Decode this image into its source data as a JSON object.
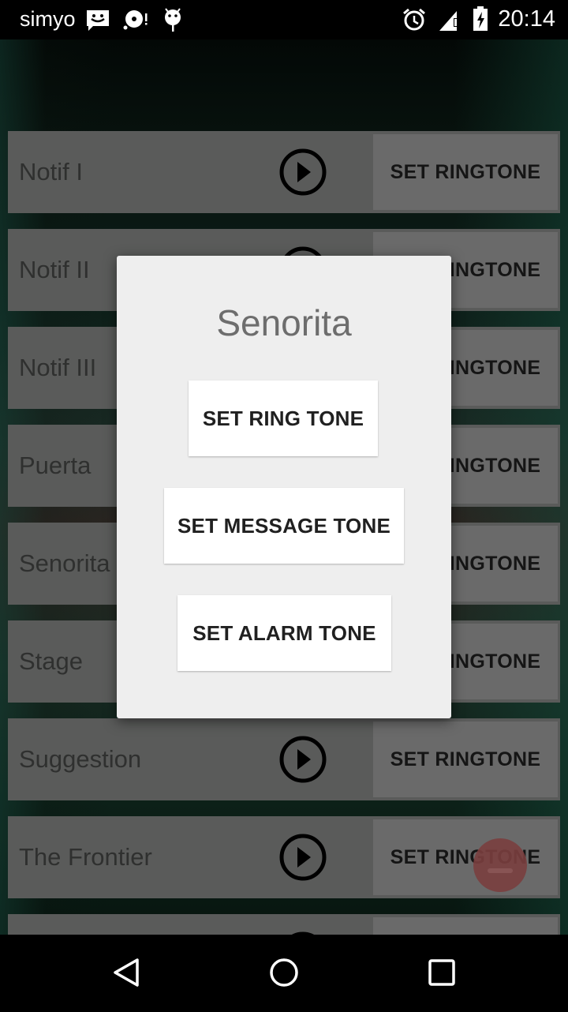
{
  "status_bar": {
    "carrier": "simyo",
    "left_icons": [
      "sms-smiley-icon",
      "sync-disc-alert-icon",
      "android-debug-icon"
    ],
    "right_icons": [
      "alarm-clock-icon",
      "signal-no-data-icon",
      "battery-charging-icon"
    ],
    "time": "20:14"
  },
  "list": {
    "rows": [
      {
        "name": "Notif I",
        "action": "SET RINGTONE"
      },
      {
        "name": "Notif II",
        "action": "SET RINGTONE"
      },
      {
        "name": "Notif III",
        "action": "SET RINGTONE"
      },
      {
        "name": "Puerta",
        "action": "SET RINGTONE"
      },
      {
        "name": "Senorita",
        "action": "SET RINGTONE"
      },
      {
        "name": "Stage",
        "action": "SET RINGTONE"
      },
      {
        "name": "Suggestion",
        "action": "SET RINGTONE"
      },
      {
        "name": "The Frontier",
        "action": "SET RINGTONE"
      },
      {
        "name": "",
        "action": ""
      }
    ]
  },
  "fab": {
    "icon": "menu-icon",
    "color": "#a04848"
  },
  "dialog": {
    "title": "Senorita",
    "buttons": {
      "ring": "SET RING TONE",
      "message": "SET MESSAGE TONE",
      "alarm": "SET ALARM TONE"
    }
  },
  "nav_bar": {
    "back": "back-icon",
    "home": "home-icon",
    "recents": "recents-icon"
  }
}
